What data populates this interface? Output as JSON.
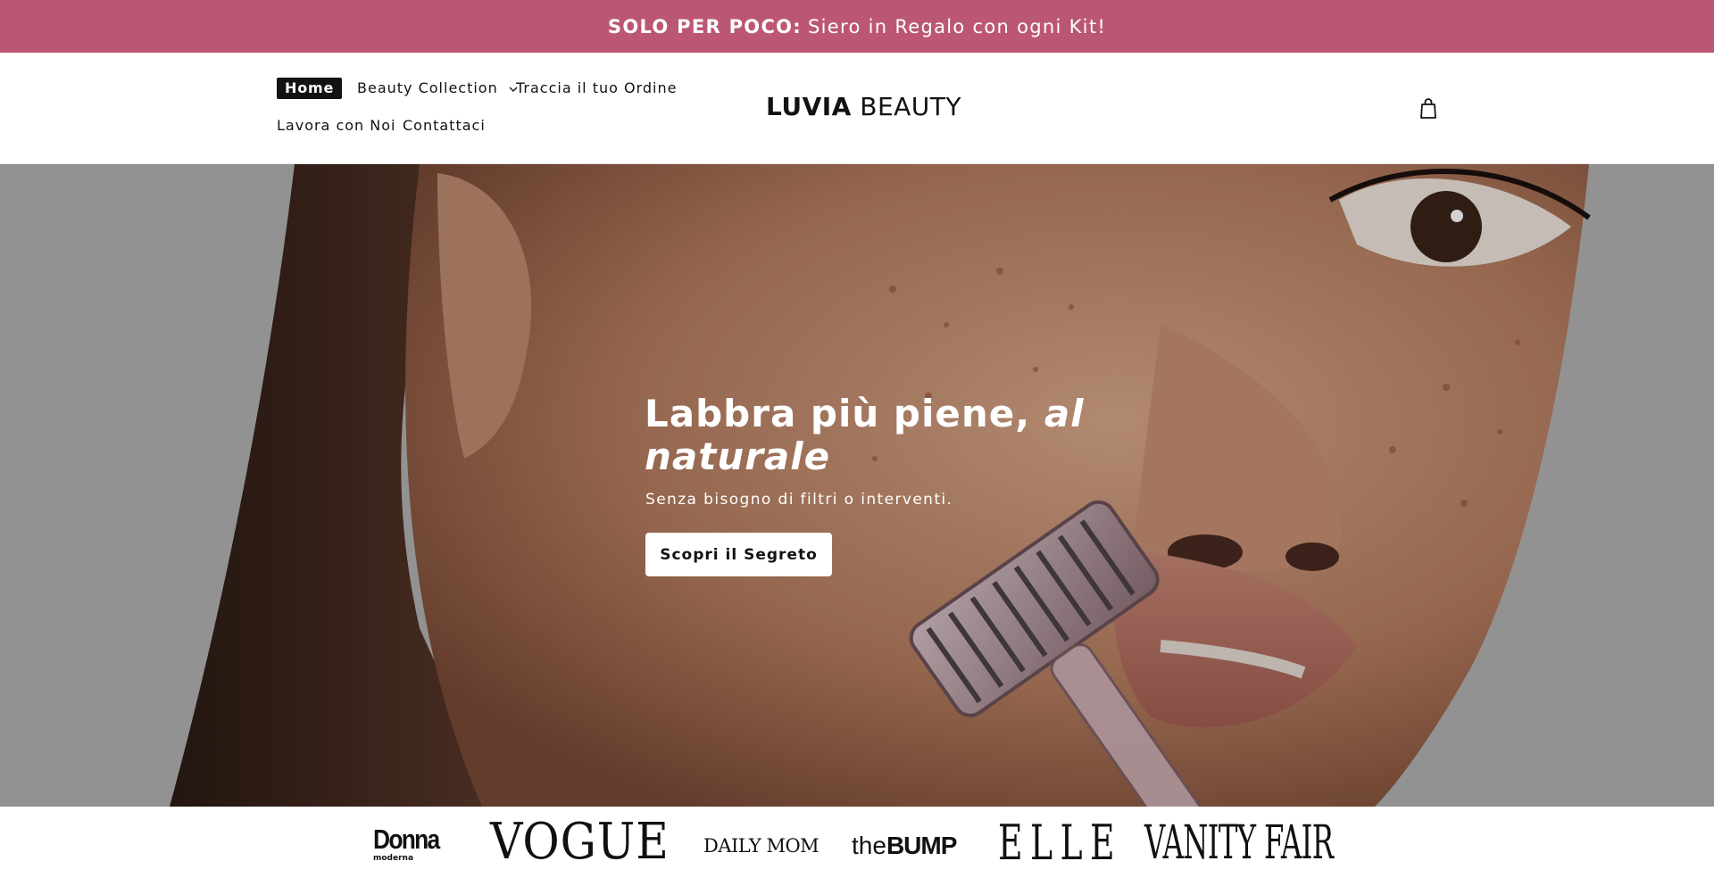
{
  "announcement": {
    "bold": "SOLO PER POCO:",
    "text": "Siero in Regalo con ogni Kit!"
  },
  "nav": {
    "items": [
      {
        "label": "Home",
        "active": true
      },
      {
        "label": "Beauty Collection",
        "has_dropdown": true
      },
      {
        "label": "Traccia il tuo Ordine"
      },
      {
        "label": "Lavora con Noi"
      },
      {
        "label": "Contattaci"
      }
    ]
  },
  "logo": {
    "strong": "LUVIA",
    "light": "BEAUTY"
  },
  "cart": {
    "icon": "shopping-bag-icon"
  },
  "hero": {
    "title_main": "Labbra più piene, ",
    "title_emph": "al naturale",
    "subtitle": "Senza bisogno di filtri o interventi.",
    "cta": "Scopri il Segreto"
  },
  "press": {
    "logos": [
      "Donna",
      "moderna",
      "VOGUE",
      "DAILY MOM",
      "the",
      "BUMP",
      "ELLE",
      "VANITY FAIR"
    ]
  },
  "colors": {
    "announcement_bg": "#bb5774",
    "text": "#121212",
    "hero_overlay": "#b5b5b5"
  }
}
